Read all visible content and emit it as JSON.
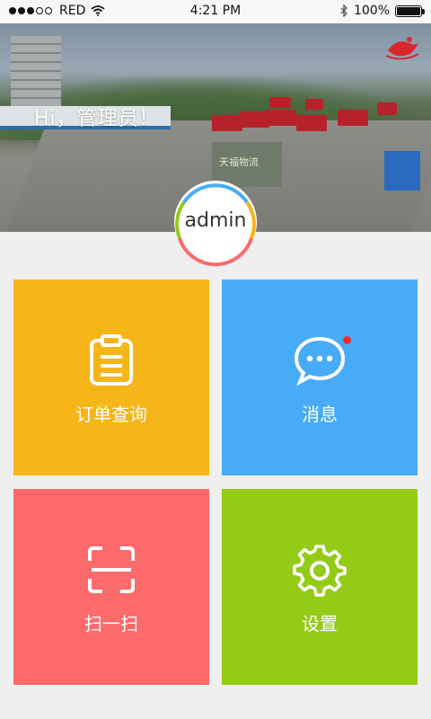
{
  "status_bar": {
    "carrier": "RED",
    "time": "4:21 PM",
    "battery": "100%",
    "battery_level": 1.0,
    "signal_bars": 3,
    "signal_total": 5
  },
  "header": {
    "greeting": "Hi，管理员！",
    "banner_sign_text": "天福物流"
  },
  "user": {
    "name": "admin"
  },
  "tiles": [
    {
      "label": "订单查询",
      "icon": "clipboard-icon",
      "color": "#f6b519"
    },
    {
      "label": "消息",
      "icon": "chat-bubble-icon",
      "color": "#48abf8",
      "has_badge": true
    },
    {
      "label": "扫一扫",
      "icon": "scan-icon",
      "color": "#fd6a6b"
    },
    {
      "label": "设置",
      "icon": "gear-icon",
      "color": "#94cb16"
    }
  ],
  "avatar_ring_colors": [
    "#48abf8",
    "#f6b519",
    "#94cb16",
    "#fd6a6b"
  ]
}
